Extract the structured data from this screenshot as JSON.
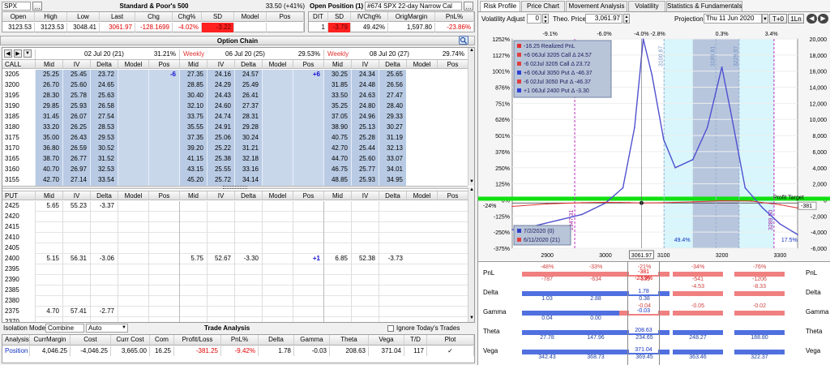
{
  "top": {
    "symbol": "SPX",
    "underlying_name": "Standard & Poor's 500",
    "underlying_meta": "33.50 (+41%)",
    "quote_headers": [
      "Open",
      "High",
      "Low",
      "Last",
      "Chg",
      "Chg%",
      "SD",
      "Model",
      "Pos"
    ],
    "quote_values": [
      "3123.53",
      "3123.53",
      "3048.41",
      "3061.97",
      "-128.1699",
      "-4.02%",
      "-3.22",
      "",
      ""
    ],
    "open_position_label": "Open Position (1)",
    "position_name": "#674 SPX 22-day Narrow Cal",
    "pos_headers": [
      "DIT",
      "SD",
      "IVChg%",
      "OrigMargin",
      "PnL%"
    ],
    "pos_values": [
      "1",
      "-3.79",
      "49.42%",
      "1,597.80",
      "-23.86%"
    ]
  },
  "option_chain": {
    "title": "Option Chain",
    "expiries": [
      {
        "label": "02 Jul 20 (21)",
        "iv": "31.21%",
        "weekly": ""
      },
      {
        "label": "06 Jul 20 (25)",
        "iv": "29.53%",
        "weekly": "Weekly"
      },
      {
        "label": "08 Jul 20 (27)",
        "iv": "29.74%",
        "weekly": "Weekly"
      }
    ],
    "call_label": "CALL",
    "put_label": "PUT",
    "col_headers": [
      "Mid",
      "IV",
      "Delta",
      "Model",
      "Pos"
    ],
    "calls": [
      [
        "3205",
        "25.25",
        "25.45",
        "23.72",
        "",
        "-6",
        "27.35",
        "24.16",
        "24.57",
        "",
        "+6",
        "30.25",
        "24.34",
        "25.65"
      ],
      [
        "3200",
        "26.70",
        "25.60",
        "24.65",
        "",
        "",
        "28.85",
        "24.29",
        "25.49",
        "",
        "",
        "31.85",
        "24.48",
        "26.56"
      ],
      [
        "3195",
        "28.30",
        "25.78",
        "25.63",
        "",
        "",
        "30.40",
        "24.43",
        "26.41",
        "",
        "",
        "33.50",
        "24.63",
        "27.47"
      ],
      [
        "3190",
        "29.85",
        "25.93",
        "26.58",
        "",
        "",
        "32.10",
        "24.60",
        "27.37",
        "",
        "",
        "35.25",
        "24.80",
        "28.40"
      ],
      [
        "3185",
        "31.45",
        "26.07",
        "27.54",
        "",
        "",
        "33.75",
        "24.74",
        "28.31",
        "",
        "",
        "37.05",
        "24.96",
        "29.33"
      ],
      [
        "3180",
        "33.20",
        "26.25",
        "28.53",
        "",
        "",
        "35.55",
        "24.91",
        "29.28",
        "",
        "",
        "38.90",
        "25.13",
        "30.27"
      ],
      [
        "3175",
        "35.00",
        "26.43",
        "29.53",
        "",
        "",
        "37.35",
        "25.06",
        "30.24",
        "",
        "",
        "40.75",
        "25.28",
        "31.19"
      ],
      [
        "3170",
        "36.80",
        "26.59",
        "30.52",
        "",
        "",
        "39.20",
        "25.22",
        "31.21",
        "",
        "",
        "42.70",
        "25.44",
        "32.13"
      ],
      [
        "3165",
        "38.70",
        "26.77",
        "31.52",
        "",
        "",
        "41.15",
        "25.38",
        "32.18",
        "",
        "",
        "44.70",
        "25.60",
        "33.07"
      ],
      [
        "3160",
        "40.70",
        "26.97",
        "32.53",
        "",
        "",
        "43.15",
        "25.55",
        "33.16",
        "",
        "",
        "46.75",
        "25.77",
        "34.01"
      ],
      [
        "3155",
        "42.70",
        "27.14",
        "33.54",
        "",
        "",
        "45.20",
        "25.72",
        "34.14",
        "",
        "",
        "48.85",
        "25.93",
        "34.95"
      ]
    ],
    "puts": [
      [
        "2425",
        "5.65",
        "55.23",
        "-3.37",
        "",
        "",
        "",
        "",
        "",
        "",
        "",
        "",
        "",
        ""
      ],
      [
        "2420",
        "",
        "",
        "",
        "",
        "",
        "",
        "",
        "",
        "",
        "",
        "",
        "",
        ""
      ],
      [
        "2415",
        "",
        "",
        "",
        "",
        "",
        "",
        "",
        "",
        "",
        "",
        "",
        "",
        ""
      ],
      [
        "2410",
        "",
        "",
        "",
        "",
        "",
        "",
        "",
        "",
        "",
        "",
        "",
        "",
        ""
      ],
      [
        "2405",
        "",
        "",
        "",
        "",
        "",
        "",
        "",
        "",
        "",
        "",
        "",
        "",
        ""
      ],
      [
        "2400",
        "5.15",
        "56.31",
        "-3.06",
        "",
        "",
        "5.75",
        "52.67",
        "-3.30",
        "",
        "+1",
        "6.85",
        "52.38",
        "-3.73"
      ],
      [
        "2395",
        "",
        "",
        "",
        "",
        "",
        "",
        "",
        "",
        "",
        "",
        "",
        "",
        ""
      ],
      [
        "2390",
        "",
        "",
        "",
        "",
        "",
        "",
        "",
        "",
        "",
        "",
        "",
        "",
        ""
      ],
      [
        "2385",
        "",
        "",
        "",
        "",
        "",
        "",
        "",
        "",
        "",
        "",
        "",
        "",
        ""
      ],
      [
        "2380",
        "",
        "",
        "",
        "",
        "",
        "",
        "",
        "",
        "",
        "",
        "",
        "",
        ""
      ],
      [
        "2375",
        "4.70",
        "57.41",
        "-2.77",
        "",
        "",
        "",
        "",
        "",
        "",
        "",
        "",
        "",
        ""
      ],
      [
        "2370",
        "",
        "",
        "",
        "",
        "",
        "",
        "",
        "",
        "",
        "",
        "",
        "",
        ""
      ]
    ]
  },
  "trade": {
    "isolation_label": "Isolation Mode",
    "isolation_value": "Combine",
    "auto_value": "Auto",
    "title": "Trade Analysis",
    "ignore_label": "Ignore Today's Trades",
    "headers": [
      "Analysis",
      "CurrMargin",
      "Cost",
      "Curr Cost",
      "Com",
      "Profit/Loss",
      "PnL%",
      "Delta",
      "Gamma",
      "Theta",
      "Vega",
      "T/D",
      "Plot"
    ],
    "row": [
      "Position",
      "4,046.25",
      "-4,046.25",
      "3,665.00",
      "16.25",
      "-381.25",
      "-9.42%",
      "1.78",
      "-0.03",
      "208.63",
      "371.04",
      "117",
      "✓"
    ]
  },
  "right": {
    "tabs": [
      "Risk Profile",
      "Price Chart",
      "Movement Analysis",
      "Volatility",
      "Statistics & Fundamentals"
    ],
    "vol_adjust_label": "Volatility Adjust",
    "vol_adjust_value": "0",
    "theo_label": "Theo. Price",
    "theo_value": "3,061.97",
    "projection_label": "Projection",
    "projection_value": "Thu 11 Jun 2020",
    "tplus_label": "T+0",
    "oneln_label": "1Ln",
    "sd_labels": [
      "-9.1%",
      "-6.0%",
      "-4.0%",
      "-2.8%",
      "0.3%",
      "3.4%"
    ],
    "legend": [
      {
        "text": "-16.25 Realized PnL",
        "color": "#e03030"
      },
      {
        "text": "+6 06Jul 3205 Call Δ  24.57",
        "color": "#e04040"
      },
      {
        "text": "-6 02Jul 3205 Call Δ  23.72",
        "color": "#e04040"
      },
      {
        "text": "+6 06Jul 3050 Put Δ  -46.37",
        "color": "#3040d0"
      },
      {
        "text": "-6 02Jul 3050 Put Δ  -46.37",
        "color": "#e04040"
      },
      {
        "text": "+1 06Jul 2400 Put Δ  -3.30",
        "color": "#3040d0"
      }
    ],
    "legend2": [
      "7/2/2020 (0)",
      "6/11/2020 (21)"
    ],
    "profit_target": "Profit Target",
    "right_value": "-381",
    "left_pct": "-24%",
    "tags": [
      "2947.31",
      "3100.67",
      "3189.81",
      "3229.57",
      "3289.50"
    ],
    "pct_labels": [
      "49.4%",
      "17.5%"
    ],
    "x_ticks": [
      "2900",
      "3000",
      "3061.97",
      "3100",
      "3200",
      "3300"
    ],
    "greeks": [
      {
        "name": "PnL",
        "tops": [
          "-48%",
          "-33%",
          "-21%",
          "-34%",
          "-76%"
        ],
        "bottoms": [
          "-787",
          "-634",
          "-339",
          "-541",
          "-1206"
        ],
        "center": "-381",
        "center2": "-23.9%"
      },
      {
        "name": "Delta",
        "tops": [
          "",
          "",
          "",
          "-4.53",
          "-8.33"
        ],
        "bottoms": [
          "1.03",
          "2.88",
          "0.38",
          "",
          ""
        ],
        "center": "1.78",
        "center2": ""
      },
      {
        "name": "Gamma",
        "tops": [
          "",
          "",
          "-0.04",
          "-0.05",
          "-0.02"
        ],
        "bottoms": [
          "0.04",
          "0.00",
          "",
          "",
          ""
        ],
        "center": "-0.03",
        "center2": ""
      },
      {
        "name": "Theta",
        "tops": [
          "",
          "",
          "",
          "",
          ""
        ],
        "bottoms": [
          "27.78",
          "147.96",
          "234.65",
          "248.27",
          "188.80"
        ],
        "center": "208.63",
        "center2": ""
      },
      {
        "name": "Vega",
        "tops": [
          "",
          "",
          "",
          "",
          ""
        ],
        "bottoms": [
          "342.43",
          "368.73",
          "369.45",
          "363.46",
          "322.37"
        ],
        "center": "371.04",
        "center2": ""
      }
    ]
  },
  "chart_data": {
    "type": "line",
    "x_range": [
      2840,
      3330
    ],
    "y_left_ticks": [
      "1252%",
      "1127%",
      "1001%",
      "876%",
      "751%",
      "626%",
      "501%",
      "376%",
      "250%",
      "125%",
      "0%",
      "-125%",
      "-250%",
      "-375%"
    ],
    "y_right_ticks": [
      "20,000",
      "18,000",
      "16,000",
      "14,000",
      "12,000",
      "10,000",
      "8,000",
      "6,000",
      "4,000",
      "2,000",
      "0",
      "-2,000",
      "-4,000",
      "-6,000"
    ],
    "y_right_range": [
      -6000,
      20000
    ],
    "series": [
      {
        "name": "7/2/2020 (0)",
        "color": "#5050d0",
        "x": [
          2840,
          2880,
          2920,
          2960,
          3000,
          3030,
          3050,
          3065,
          3080,
          3100,
          3120,
          3150,
          3175,
          3200,
          3215,
          3240,
          3270,
          3300,
          3330
        ],
        "y": [
          -3700,
          -3200,
          -2500,
          -1800,
          -400,
          1500,
          9000,
          20000,
          15500,
          7500,
          4000,
          5000,
          9000,
          16500,
          11000,
          1500,
          -1000,
          -3000,
          -4300
        ]
      },
      {
        "name": "6/11/2020 (21)",
        "color": "#e03030",
        "x": [
          2840,
          2900,
          2960,
          3000,
          3040,
          3061.97,
          3100,
          3150,
          3200,
          3250,
          3300,
          3330
        ],
        "y": [
          -800,
          -500,
          -350,
          -300,
          -330,
          -381,
          -350,
          -250,
          -100,
          -150,
          -600,
          -1000
        ]
      }
    ]
  }
}
